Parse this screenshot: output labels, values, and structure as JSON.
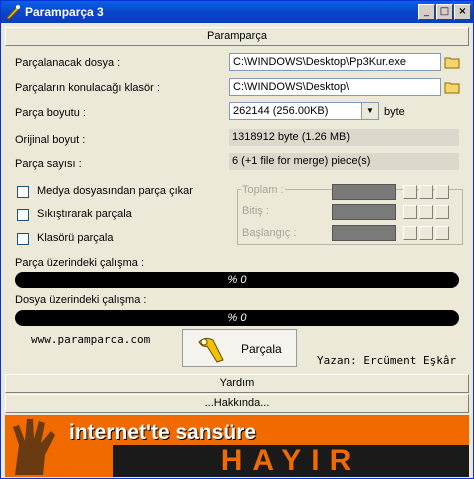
{
  "window": {
    "title": "Paramparça 3"
  },
  "header_button": "Paramparça",
  "fields": {
    "file_label": "Parçalanacak dosya :",
    "file_value": "C:\\WINDOWS\\Desktop\\Pp3Kur.exe",
    "folder_label": "Parçaların konulacağı klasör :",
    "folder_value": "C:\\WINDOWS\\Desktop\\",
    "size_label": "Parça boyutu :",
    "size_value": "262144 (256.00KB)",
    "size_unit": "byte",
    "orig_label": "Orijinal boyut :",
    "orig_value": "1318912 byte (1.26 MB)",
    "count_label": "Parça sayısı :",
    "count_value": "6 (+1 file for merge) piece(s)"
  },
  "options": {
    "media": "Medya dosyasından parça çıkar",
    "compress": "Sıkıştırarak parçala",
    "folder": "Klasörü parçala"
  },
  "group": {
    "total": "Toplam :",
    "end": "Bitiş :",
    "start": "Başlangıç :"
  },
  "progress": {
    "part_label": "Parça üzerindeki çalışma :",
    "part_value": "% 0",
    "file_label": "Dosya üzerindeki çalışma :",
    "file_value": "% 0"
  },
  "website": "www.paramparca.com",
  "action_button": "Parçala",
  "author": "Yazan: Ercüment Eşkâr",
  "help_button": "Yardım",
  "about_button": "...Hakkında...",
  "banner": {
    "line1": "internet'te sansüre",
    "line2": "HAYIR"
  }
}
